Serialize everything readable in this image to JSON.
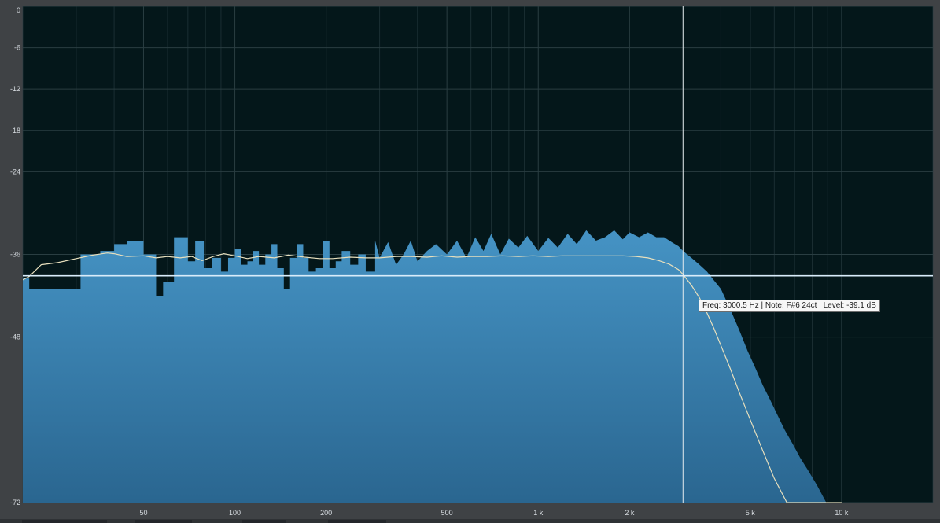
{
  "colors": {
    "background": "#04171a",
    "spectrum_fill_top": "#4593c4",
    "spectrum_fill_bottom": "#2a6690",
    "average_curve": "#e7dfbd",
    "peak_hold_line": "#d9ecfa",
    "cursor_line": "#e6ecef",
    "grid": "#2a3e42"
  },
  "cursor": {
    "tooltip": "Freq: 3000.5 Hz | Note: F#6 24ct | Level: -39.1 dB",
    "frequency_hz": 3000.5,
    "level_db": -39.1
  },
  "chart_data": {
    "type": "area",
    "x_scale": "log",
    "xlim": [
      20,
      20000
    ],
    "ylim": [
      -72,
      0
    ],
    "grid": true,
    "y_ticks": [
      0,
      -6,
      -12,
      -18,
      -24,
      -36,
      -48,
      -72
    ],
    "y_tick_labels": [
      "0",
      "-6",
      "-12",
      "-18",
      "-24",
      "-36",
      "-48",
      "-72"
    ],
    "x_ticks": [
      50,
      100,
      200,
      500,
      1000,
      2000,
      5000,
      10000
    ],
    "x_tick_labels": [
      "50",
      "100",
      "200",
      "500",
      "1 k",
      "2 k",
      "5 k",
      "10 k"
    ],
    "reference_level_db": -39.1,
    "series": [
      {
        "x": [
          20,
          21,
          24,
          31,
          34,
          36,
          40,
          44,
          50,
          55,
          58,
          63,
          70,
          74,
          79,
          84,
          90,
          95,
          100,
          105,
          110,
          115,
          120,
          126,
          132,
          138,
          145,
          152,
          160,
          168,
          175,
          185,
          195,
          205,
          215,
          225,
          240,
          255,
          270,
          290,
          300,
          320,
          340,
          360,
          380,
          400,
          430,
          460,
          500,
          540,
          580,
          620,
          660,
          700,
          750,
          800,
          860,
          920,
          1000,
          1080,
          1160,
          1250,
          1340,
          1440,
          1550,
          1660,
          1780,
          1900,
          2000,
          2150,
          2300,
          2450,
          2600,
          2750,
          2900,
          3000,
          3200,
          3400,
          3600,
          3800,
          4000,
          4300,
          4600,
          4900,
          5200,
          5500,
          5800,
          6100,
          6500,
          6900,
          7300,
          7800,
          8300,
          8900,
          9500,
          10100,
          10800,
          11500,
          12200,
          20000
        ],
        "y": [
          -39.5,
          -41,
          -41,
          -36,
          -36,
          -35.5,
          -34.5,
          -34,
          -36,
          -42,
          -40,
          -33.5,
          -37,
          -34,
          -38,
          -36.5,
          -38.5,
          -36.5,
          -35.2,
          -37.5,
          -37,
          -35.5,
          -37.5,
          -36,
          -34.5,
          -38,
          -41,
          -36.5,
          -34.5,
          -36.5,
          -38.5,
          -38,
          -34,
          -38,
          -37,
          -35.5,
          -37.5,
          -36,
          -38.5,
          -34,
          -36.5,
          -34.2,
          -37.5,
          -36,
          -34,
          -37,
          -35.5,
          -34.5,
          -36,
          -34,
          -36.5,
          -33.5,
          -35.5,
          -33,
          -36,
          -33.7,
          -35,
          -33.3,
          -35.5,
          -33.6,
          -35,
          -33,
          -34.5,
          -32.5,
          -34,
          -33.5,
          -32.5,
          -33.8,
          -32.8,
          -33.5,
          -32.8,
          -33.5,
          -33.5,
          -34.2,
          -34.8,
          -35.5,
          -36.5,
          -37.5,
          -38.5,
          -39.8,
          -41,
          -44,
          -47,
          -50,
          -52.5,
          -55,
          -57,
          -59,
          -61.5,
          -63.5,
          -65.5,
          -67.5,
          -69.5,
          -72,
          -72,
          -72,
          -72,
          -72,
          -72,
          -72
        ]
      },
      {
        "x": [
          20,
          21,
          23,
          26,
          30,
          34,
          38,
          40,
          44,
          50,
          55,
          60,
          66,
          72,
          78,
          85,
          92,
          100,
          110,
          120,
          135,
          150,
          170,
          190,
          210,
          240,
          270,
          300,
          340,
          380,
          430,
          480,
          540,
          600,
          680,
          760,
          860,
          960,
          1080,
          1200,
          1350,
          1500,
          1700,
          1900,
          2100,
          2300,
          2500,
          2700,
          2900,
          3000,
          3200,
          3400,
          3600,
          3800,
          4000,
          4300,
          4600,
          5000,
          5500,
          6000,
          6600,
          7200,
          7800,
          8500,
          9200,
          10000
        ],
        "y": [
          -39.7,
          -39.2,
          -37.5,
          -37.2,
          -36.6,
          -36.1,
          -35.8,
          -35.9,
          -36.3,
          -36.2,
          -36.5,
          -36.3,
          -36.5,
          -36.3,
          -36.9,
          -36.3,
          -35.9,
          -36.2,
          -36.6,
          -36.3,
          -36.5,
          -36.1,
          -36.4,
          -36.6,
          -36.6,
          -36.4,
          -36.5,
          -36.5,
          -36.3,
          -36.3,
          -36.4,
          -36.2,
          -36.4,
          -36.3,
          -36.3,
          -36.2,
          -36.3,
          -36.2,
          -36.3,
          -36.2,
          -36.2,
          -36.2,
          -36.2,
          -36.2,
          -36.3,
          -36.5,
          -36.9,
          -37.4,
          -38.2,
          -38.9,
          -40.5,
          -42.3,
          -44.5,
          -46.8,
          -49.2,
          -52.6,
          -56,
          -60,
          -64.5,
          -68.5,
          -72,
          -72,
          -72,
          -72,
          -72,
          -72
        ]
      },
      {
        "x": [
          20,
          20000
        ],
        "y": [
          -39.1,
          -39.1
        ]
      }
    ]
  }
}
